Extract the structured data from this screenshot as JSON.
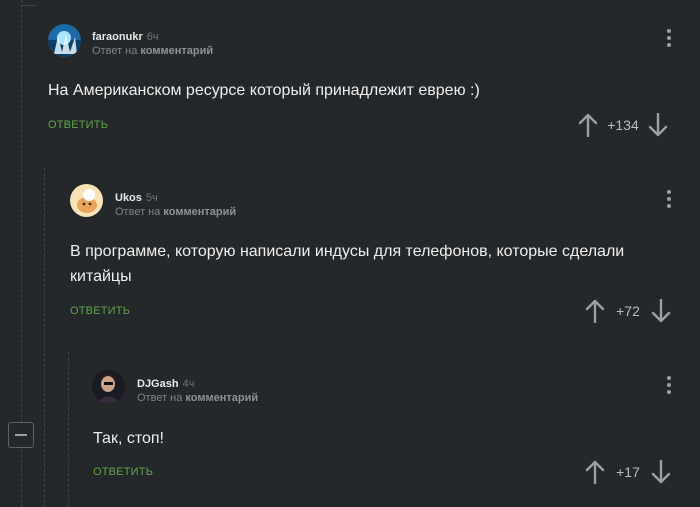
{
  "reply_label": "ОТВЕТИТЬ",
  "reply_to_prefix": "Ответ на",
  "reply_to_target": "комментарий",
  "colors": {
    "background": "#25282b",
    "reply_green": "#5ea648",
    "thread_line": "#3e4347"
  },
  "comments": [
    {
      "author": "faraonukr",
      "time": "6ч",
      "text": "На Американском ресурсе который принадлежит еврею :)",
      "score": "+134",
      "avatar_icon": "frost-avatar-icon"
    },
    {
      "author": "Ukos",
      "time": "5ч",
      "text": "В программе, которую написали индусы для телефонов, которые сделали китайцы",
      "score": "+72",
      "avatar_icon": "cartoon-avatar-icon"
    },
    {
      "author": "DJGash",
      "time": "4ч",
      "text": "Так, стоп!",
      "score": "+17",
      "avatar_icon": "photo-avatar-icon"
    }
  ]
}
